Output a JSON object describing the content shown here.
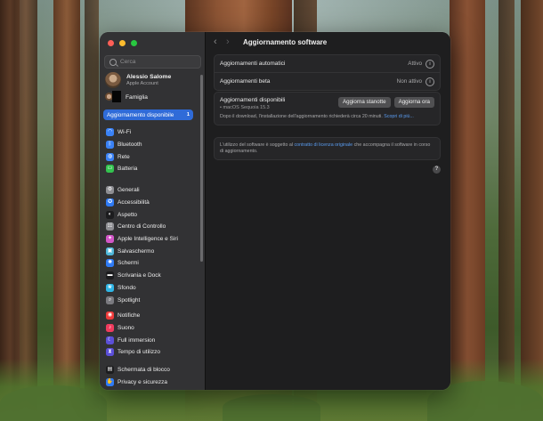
{
  "window": {
    "title": "Aggiornamento software"
  },
  "sidebar": {
    "search": {
      "placeholder": "Cerca"
    },
    "account": {
      "name": "Alessio Salome",
      "subtitle": "Apple Account"
    },
    "family": {
      "label": "Famiglia"
    },
    "update_row": {
      "label": "Aggiornamento disponibile",
      "count": "1"
    },
    "groups": [
      [
        {
          "label": "Wi-Fi",
          "icon": "wifi-icon",
          "color": "#3a82f7",
          "glyph": "◠"
        },
        {
          "label": "Bluetooth",
          "icon": "bluetooth-icon",
          "color": "#3a82f7",
          "glyph": "ᛒ"
        },
        {
          "label": "Rete",
          "icon": "network-icon",
          "color": "#3a82f7",
          "glyph": "◍"
        },
        {
          "label": "Batteria",
          "icon": "battery-icon",
          "color": "#33c34f",
          "glyph": "▭"
        }
      ],
      [
        {
          "label": "Generali",
          "icon": "gear-icon",
          "color": "#8e8e93",
          "glyph": "⚙"
        },
        {
          "label": "Accessibilità",
          "icon": "accessibility-icon",
          "color": "#2f7bf6",
          "glyph": "✪"
        },
        {
          "label": "Aspetto",
          "icon": "appearance-icon",
          "color": "#1c1c1e",
          "glyph": "◐"
        },
        {
          "label": "Centro di Controllo",
          "icon": "control-center-icon",
          "color": "#8e8e93",
          "glyph": "☷"
        },
        {
          "label": "Apple Intelligence e Siri",
          "icon": "siri-icon",
          "color": "#d257c8",
          "glyph": "✦"
        },
        {
          "label": "Salvaschermo",
          "icon": "screensaver-icon",
          "color": "#4fb7d9",
          "glyph": "▣"
        },
        {
          "label": "Schermi",
          "icon": "displays-icon",
          "color": "#2f7bf6",
          "glyph": "✺"
        },
        {
          "label": "Scrivania e Dock",
          "icon": "dock-icon",
          "color": "#1c1c1e",
          "glyph": "▬"
        },
        {
          "label": "Sfondo",
          "icon": "wallpaper-icon",
          "color": "#2fb5e6",
          "glyph": "❀"
        },
        {
          "label": "Spotlight",
          "icon": "spotlight-icon",
          "color": "#7a7a80",
          "glyph": "⌕"
        }
      ],
      [
        {
          "label": "Notifiche",
          "icon": "notifications-icon",
          "color": "#ef3b3b",
          "glyph": "◉"
        },
        {
          "label": "Suono",
          "icon": "sound-icon",
          "color": "#ef3b5e",
          "glyph": "♪"
        },
        {
          "label": "Full immersion",
          "icon": "focus-icon",
          "color": "#5b4fd8",
          "glyph": "☾"
        },
        {
          "label": "Tempo di utilizzo",
          "icon": "screen-time-icon",
          "color": "#5b4fd8",
          "glyph": "⧗"
        }
      ],
      [
        {
          "label": "Schermata di blocco",
          "icon": "lock-screen-icon",
          "color": "#1c1c1e",
          "glyph": "▤"
        },
        {
          "label": "Privacy e sicurezza",
          "icon": "privacy-icon",
          "color": "#2f7bf6",
          "glyph": "✋"
        }
      ]
    ]
  },
  "main": {
    "settings": [
      {
        "label": "Aggiornamenti automatici",
        "value": "Attivo"
      },
      {
        "label": "Aggiornamenti beta",
        "value": "Non attivo"
      }
    ],
    "available": {
      "title": "Aggiornamenti disponibili",
      "item": "• macOS Sequoia 15.3",
      "btn_tonight": "Aggiorna stanotte",
      "btn_now": "Aggiorna ora",
      "download_text": "Dopo il download, l'installazione dell'aggiornamento richiederà circa 20 minuti.",
      "learn_more": "Scopri di più..."
    },
    "license": {
      "pre": "L'utilizzo del software è soggetto al ",
      "link": "contratto di licenza originale",
      "post": " che accompagna il software in corso di aggiornamento."
    },
    "help": "?"
  }
}
